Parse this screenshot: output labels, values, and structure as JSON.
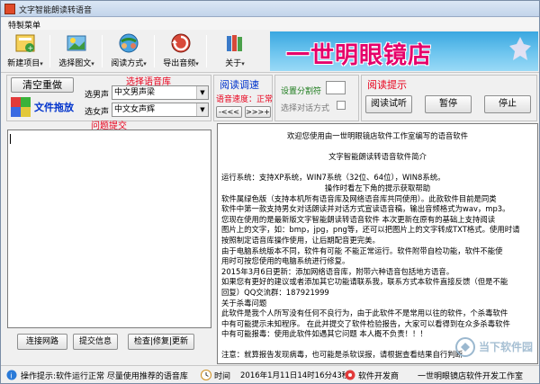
{
  "window": {
    "title": "文字智能朗读转语音"
  },
  "menu": {
    "main_menu": "特製菜单"
  },
  "toolbar": [
    {
      "name": "new-project",
      "label": "新建项目"
    },
    {
      "name": "select-image-text",
      "label": "选择图文"
    },
    {
      "name": "read-mode",
      "label": "阅读方式"
    },
    {
      "name": "export-audio",
      "label": "导出音频"
    },
    {
      "name": "about",
      "label": "关于"
    }
  ],
  "banner": {
    "headline": "一世明眼镜店"
  },
  "panel_left": {
    "clear_button": "清空重做",
    "file_drag": "文件拖放",
    "voice_lib_title": "选择语音库",
    "male_label": "选男声",
    "male_value": "中文男声梁",
    "female_label": "选女声",
    "female_value": "中文女声辉"
  },
  "panel_speed": {
    "title": "阅读调速",
    "speed_label": "语音速度：正常",
    "slower_button": "-<<<",
    "faster_button": ">>>+"
  },
  "panel_settings": {
    "split_label": "设置分割符",
    "dialog_mode_label": "选择对话方式"
  },
  "panel_tips": {
    "title": "阅读提示",
    "trial_button": "阅读试听",
    "pause_button": "暂停",
    "stop_button": "停止"
  },
  "left_area": {
    "title": "问题提交"
  },
  "bottom_buttons": {
    "connect": "连接网路",
    "submit": "提交信息",
    "check": "检查|修复|更新"
  },
  "content": {
    "lines": [
      "欢迎您使用由一世明眼镜店软件工作室编写的语音软件",
      "",
      "文字智能朗读转语音软件简介",
      "",
      "运行系统：支持XP系统，WIN7系统（32位、64位），WIN8系统。",
      "操作时看左下角的提示获取帮助",
      "软件属绿色版（支持本机所有语音库及网络语音库共同使用）。此款软件目前是同类",
      "软件中第一款支持男女对话朗读并对话方式宣读语音稿，输出音频格式为wav，mp3。",
      "您现在使用的是最新版文字智能朗读转语音软件  本次更新在原有的基础上支持阅读",
      "图片上的文字，如：bmp，jpg，png等，还可以把图片上的文字转成TXT格式。使用时请",
      "按照制定语音库操作使用，让后期配音更完美。",
      "由于电脑系统版本不同，软件有可能    不能正常运行。软件附带自检功能，软件不能使",
      "用时可按您使用的电脑系统进行修复。",
      "2015年3月6日更新：添加网络语音库，附带六种语音包括地方语音。",
      "如果您有更好的建议或者添加其它功能请联系我，联系方式本软件直接反馈（但是不能",
      "回复）QQ交流群：187921999",
      "关于杀毒问题",
      "此软件是我个人所写没有任何不良行为，由于此软件不是常用以往的软件，个杀毒软件",
      "中有可能提示未知程序。  在此并提交了软件检验报告，大家可以看得到在众多杀毒软件",
      "中有可能报毒：使用此软件如遇其它问题    本人概不负责！！！",
      "",
      "注意：就算报告发现病毒，也可能是杀软误报，请根据查看结果自行判断"
    ]
  },
  "status": {
    "tip": "操作提示:软件运行正常 尽量使用推荐的语音库",
    "time_label": "时间",
    "time_value": "2016年1月11日14时16分43秒",
    "developer": "软件开发商",
    "studio": "一世明眼镜店软件开发工作室"
  },
  "watermark": {
    "text": "当下软件园"
  },
  "colors": {
    "red_title": "#e8001c",
    "magenta_banner": "#e5006a",
    "blue_link": "#0033cc",
    "banner_sky": "#3aa7e0"
  }
}
